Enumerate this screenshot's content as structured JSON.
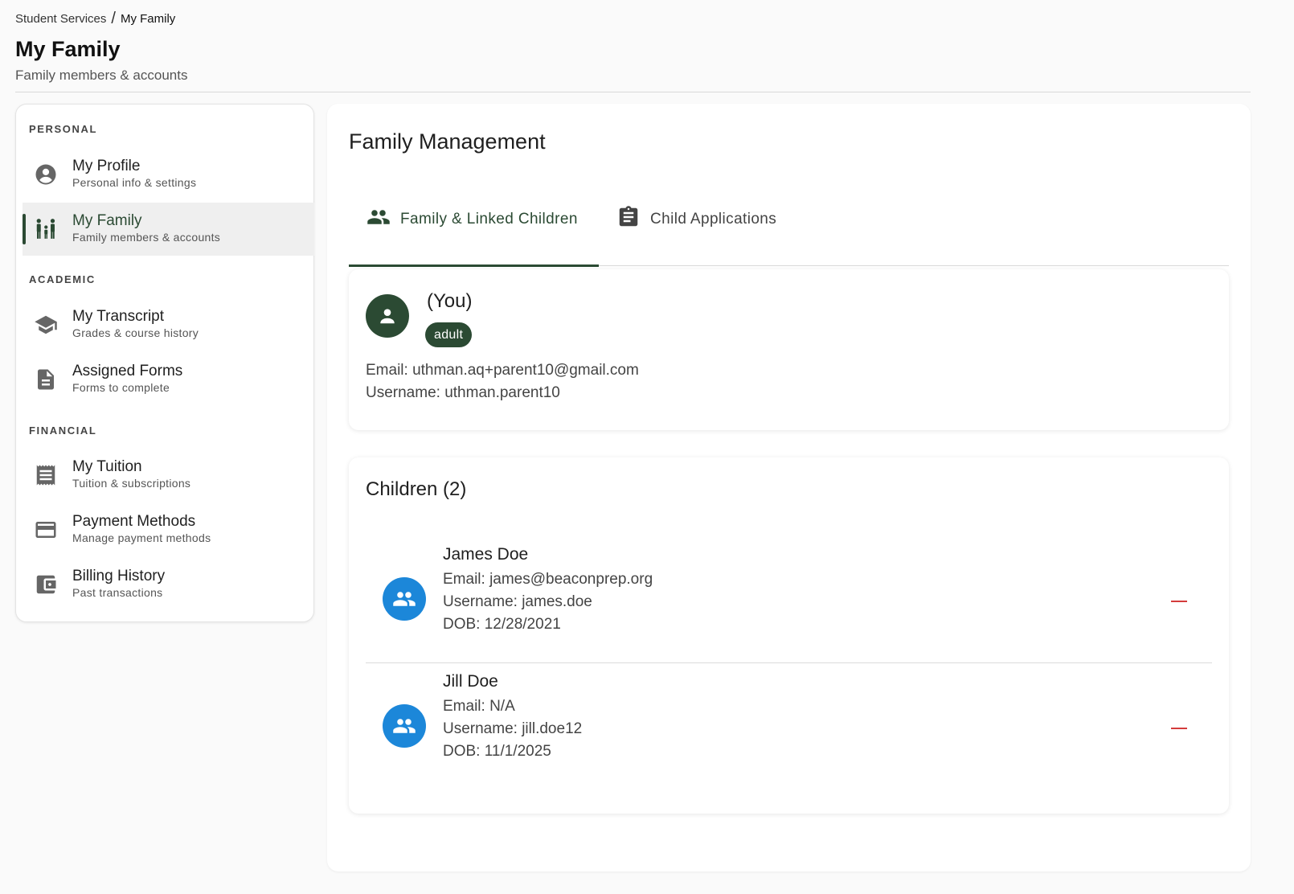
{
  "breadcrumb": {
    "parent": "Student Services",
    "separator": "/",
    "current": "My Family"
  },
  "page": {
    "title": "My Family",
    "subtitle": "Family members & accounts"
  },
  "sidebar": {
    "sections": [
      {
        "label": "PERSONAL"
      },
      {
        "label": "ACADEMIC"
      },
      {
        "label": "FINANCIAL"
      }
    ],
    "items": [
      {
        "title": "My Profile",
        "sub": "Personal info & settings",
        "icon": "account-circle-icon"
      },
      {
        "title": "My Family",
        "sub": "Family members & accounts",
        "icon": "family-icon",
        "active": true
      },
      {
        "title": "My Transcript",
        "sub": "Grades & course history",
        "icon": "graduation-cap-icon"
      },
      {
        "title": "Assigned Forms",
        "sub": "Forms to complete",
        "icon": "document-icon"
      },
      {
        "title": "My Tuition",
        "sub": "Tuition & subscriptions",
        "icon": "receipt-icon"
      },
      {
        "title": "Payment Methods",
        "sub": "Manage payment methods",
        "icon": "credit-card-icon"
      },
      {
        "title": "Billing History",
        "sub": "Past transactions",
        "icon": "wallet-icon"
      }
    ]
  },
  "main": {
    "title": "Family Management",
    "tabs": [
      {
        "label": "Family & Linked Children",
        "icon": "people-icon",
        "active": true
      },
      {
        "label": "Child Applications",
        "icon": "clipboard-icon"
      }
    ],
    "profile": {
      "name": "(You)",
      "role": "adult",
      "email": "Email: uthman.aq+parent10@gmail.com",
      "username": "Username: uthman.parent10"
    },
    "children": {
      "title": "Children (2)",
      "items": [
        {
          "name": "James Doe",
          "email": "Email: james@beaconprep.org",
          "username": "Username: james.doe",
          "dob": "DOB: 12/28/2021"
        },
        {
          "name": "Jill Doe",
          "email": "Email: N/A",
          "username": "Username: jill.doe12",
          "dob": "DOB: 11/1/2025"
        }
      ]
    }
  },
  "colors": {
    "accent": "#2b4a33",
    "child_avatar": "#1c87d9",
    "remove": "#d43b3b"
  }
}
